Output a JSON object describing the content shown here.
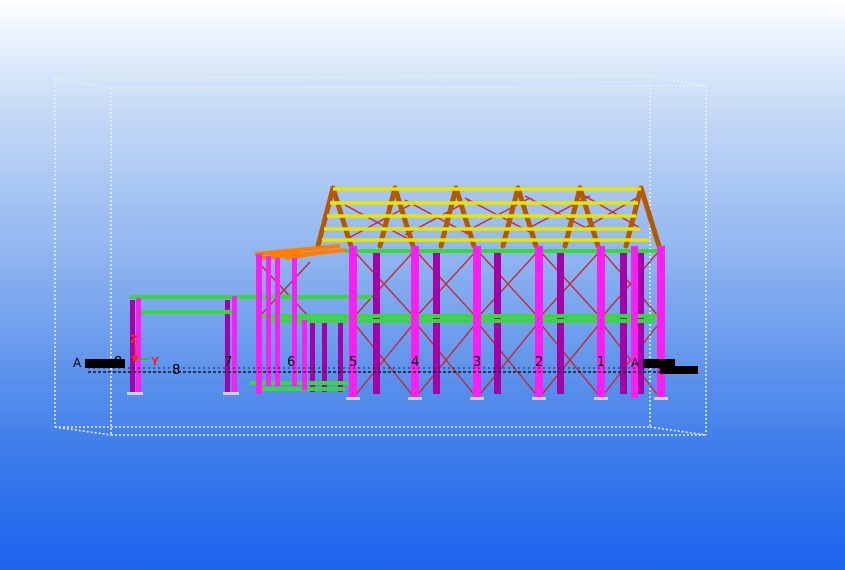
{
  "view": {
    "background_top": "#ffffff",
    "background_bottom": "#1c63ee"
  },
  "colors": {
    "column": "#ff1ef0",
    "column_dark": "#a800a8",
    "rafter": "#b35a00",
    "purlin": "#e0e000",
    "beam": "#38d838",
    "brace": "#c8283a",
    "canopy": "#ff7d00",
    "bbox": "#e8ecec"
  },
  "axis_triad": {
    "z_label": "Z",
    "y_label": "Y",
    "z_color": "#ff2020",
    "y_color": "#ff2020",
    "x_color": "#20c020"
  },
  "grid_labels": {
    "left_caps": "A",
    "right_caps": "A",
    "lines": [
      "8",
      "7",
      "6",
      "5",
      "4",
      "3",
      "2",
      "1"
    ]
  }
}
